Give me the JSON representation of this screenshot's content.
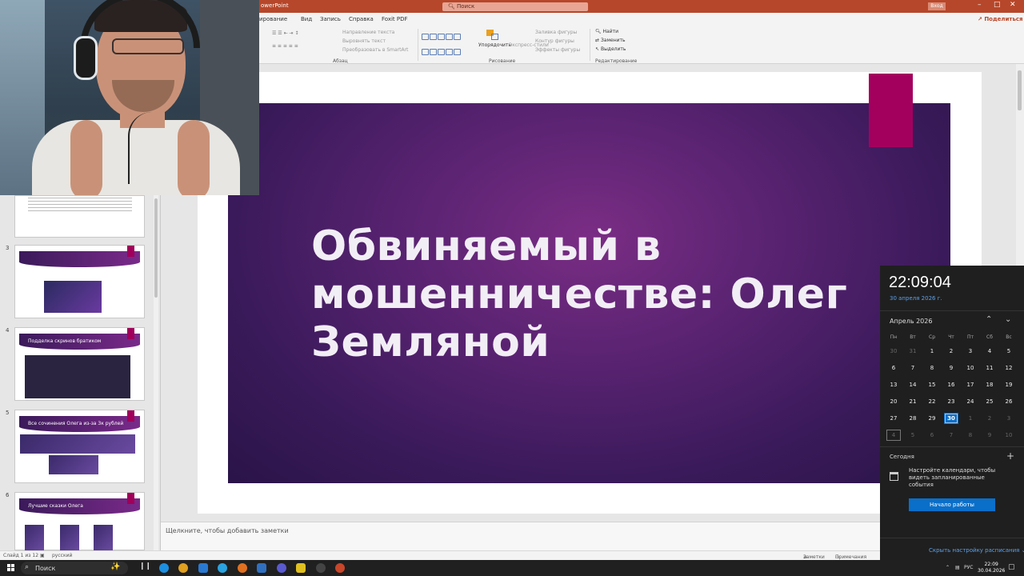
{
  "app": {
    "title_fragment": "owerPoint",
    "search_placeholder": "Поиск",
    "signin_label": "Вход",
    "share_label": "Поделиться"
  },
  "ribbon": {
    "tabs": [
      "ирование",
      "Вид",
      "Запись",
      "Справка",
      "Foxit PDF"
    ],
    "paragraph": {
      "text_direction": "Направление текста",
      "align_text": "Выровнять текст",
      "convert_smartart": "Преобразовать в SmartArt",
      "group_label": "Абзац"
    },
    "drawing": {
      "arrange_label": "Упорядочить",
      "express_styles": "Экспресс-стили",
      "shape_fill": "Заливка фигуры",
      "shape_outline": "Контур фигуры",
      "shape_effects": "Эффекты фигуры",
      "group_label": "Рисование"
    },
    "editing": {
      "find": "Найти",
      "replace": "Заменить",
      "select": "Выделить",
      "group_label": "Редактирование"
    }
  },
  "thumbnails": [
    {
      "num": "3",
      "title": ""
    },
    {
      "num": "4",
      "title": "Подделка скринов братиком"
    },
    {
      "num": "5",
      "title": "Все сочинения Олега из-за 3к рублей"
    },
    {
      "num": "6",
      "title": "Лучшие сказки Олега"
    }
  ],
  "slide": {
    "title": "Обвиняемый в мошенничестве: Олег Земляной"
  },
  "notes_placeholder": "Щелкните, чтобы добавить заметки",
  "status": {
    "slide_info": "Слайд 1 из 12",
    "language": "русский",
    "notes_btn": "Заметки",
    "comments_btn": "Примечания"
  },
  "calendar": {
    "time": "22:09:04",
    "date_long": "30 апреля 2026 г.",
    "month_label": "Апрель 2026",
    "weekdays": [
      "Пн",
      "Вт",
      "Ср",
      "Чт",
      "Пт",
      "Сб",
      "Вс"
    ],
    "weeks": [
      [
        "30",
        "31",
        "1",
        "2",
        "3",
        "4",
        "5"
      ],
      [
        "6",
        "7",
        "8",
        "9",
        "10",
        "11",
        "12"
      ],
      [
        "13",
        "14",
        "15",
        "16",
        "17",
        "18",
        "19"
      ],
      [
        "20",
        "21",
        "22",
        "23",
        "24",
        "25",
        "26"
      ],
      [
        "27",
        "28",
        "29",
        "30",
        "1",
        "2",
        "3"
      ],
      [
        "4",
        "5",
        "6",
        "7",
        "8",
        "9",
        "10"
      ]
    ],
    "today_label": "Сегодня",
    "empty_message": "Настройте календари, чтобы видеть запланированные события",
    "get_started": "Начало работы",
    "hide_agenda": "Скрыть настройку расписания"
  },
  "taskbar": {
    "search_label": "Поиск",
    "lang": "РУС",
    "clock_time": "22:09",
    "clock_date": "30.04.2026"
  },
  "colors": {
    "accent_red": "#b7472a",
    "slide_magenta": "#a3005e",
    "calendar_blue": "#0a6fc9"
  }
}
